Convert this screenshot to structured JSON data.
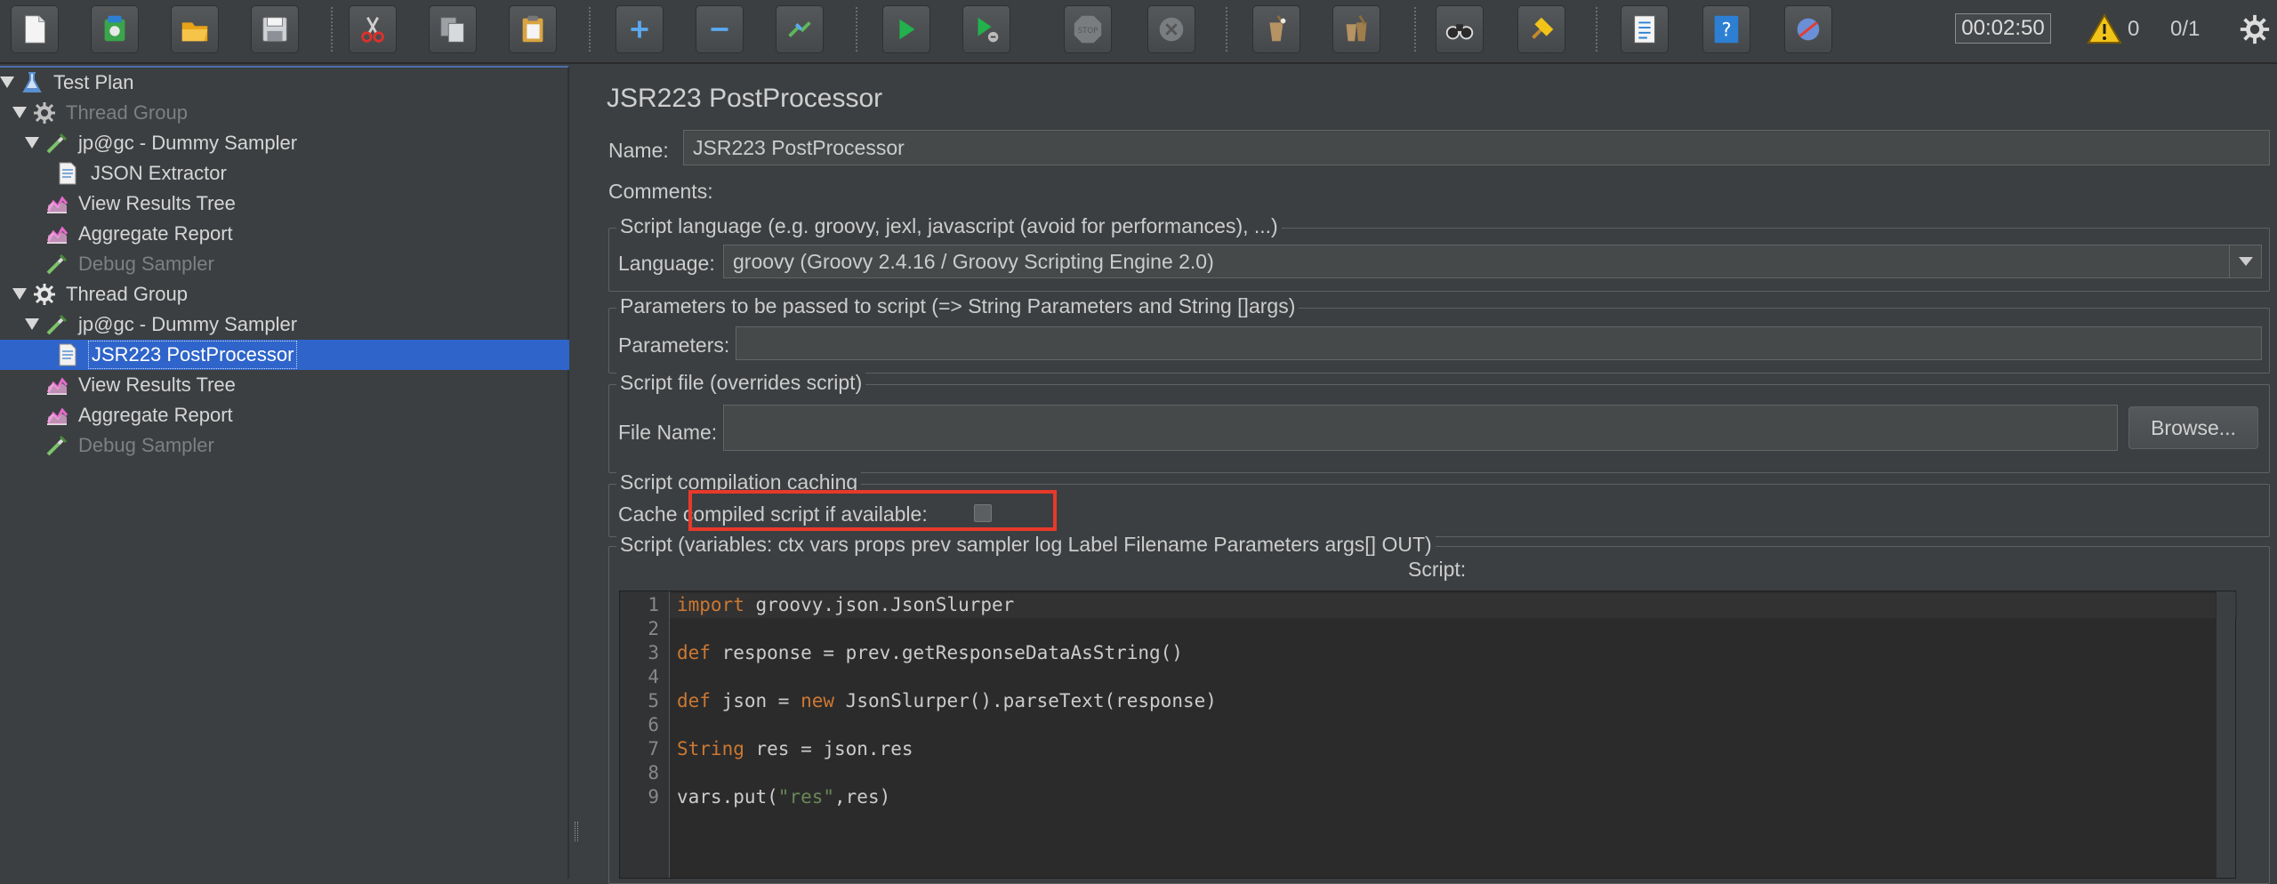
{
  "toolbar": {
    "buttons": [
      {
        "name": "new-icon"
      },
      {
        "name": "templates-icon"
      },
      {
        "name": "open-icon"
      },
      {
        "name": "save-icon"
      },
      {
        "name": "cut-icon"
      },
      {
        "name": "copy-icon"
      },
      {
        "name": "paste-icon"
      },
      {
        "name": "expand-icon"
      },
      {
        "name": "collapse-icon"
      },
      {
        "name": "toggle-icon"
      },
      {
        "name": "start-icon"
      },
      {
        "name": "start-no-pauses-icon"
      },
      {
        "name": "stop-icon"
      },
      {
        "name": "shutdown-icon"
      },
      {
        "name": "clear-icon"
      },
      {
        "name": "clear-all-icon"
      },
      {
        "name": "search-icon"
      },
      {
        "name": "reset-search-icon"
      },
      {
        "name": "function-helper-icon"
      },
      {
        "name": "help-icon"
      }
    ],
    "timer": "00:02:50",
    "warning_count": "0",
    "threads": "0/1",
    "colors": {
      "start": "#22b14c",
      "warning": "#f2c318"
    }
  },
  "tree": {
    "items": [
      {
        "label": "Test Plan",
        "icon": "flask-icon",
        "level": 0,
        "expanded": true,
        "disabled": false
      },
      {
        "label": "Thread Group",
        "icon": "gear-icon",
        "level": 0,
        "expanded": true,
        "disabled": true
      },
      {
        "label": "jp@gc - Dummy Sampler",
        "icon": "pipette-icon",
        "level": 1,
        "expanded": true,
        "disabled": false
      },
      {
        "label": "JSON Extractor",
        "icon": "document-icon",
        "level": 2,
        "disabled": false
      },
      {
        "label": "View Results Tree",
        "icon": "chart-icon",
        "level": 1,
        "disabled": false
      },
      {
        "label": "Aggregate Report",
        "icon": "chart-icon",
        "level": 1,
        "disabled": false
      },
      {
        "label": "Debug Sampler",
        "icon": "pipette-icon",
        "level": 1,
        "disabled": true
      },
      {
        "label": "Thread Group",
        "icon": "gear-icon",
        "level": 0,
        "expanded": true,
        "disabled": false
      },
      {
        "label": "jp@gc - Dummy Sampler",
        "icon": "pipette-icon",
        "level": 1,
        "expanded": true,
        "disabled": false
      },
      {
        "label": "JSR223 PostProcessor",
        "icon": "document-icon",
        "level": 2,
        "selected": true,
        "disabled": false
      },
      {
        "label": "View Results Tree",
        "icon": "chart-icon",
        "level": 1,
        "disabled": false
      },
      {
        "label": "Aggregate Report",
        "icon": "chart-icon",
        "level": 1,
        "disabled": false
      },
      {
        "label": "Debug Sampler",
        "icon": "pipette-icon",
        "level": 1,
        "disabled": true
      }
    ]
  },
  "main": {
    "title": "JSR223 PostProcessor",
    "name_label": "Name:",
    "name_value": "JSR223 PostProcessor",
    "comments_label": "Comments:",
    "script_language": {
      "title": "Script language (e.g. groovy, jexl, javascript (avoid for performances), ...)",
      "label": "Language:",
      "value": "groovy     (Groovy 2.4.16 / Groovy Scripting Engine 2.0)"
    },
    "parameters": {
      "title": "Parameters to be passed to script (=> String Parameters and String []args)",
      "label": "Parameters:",
      "value": ""
    },
    "script_file": {
      "title": "Script file (overrides script)",
      "label": "File Name:",
      "value": "",
      "browse_label": "Browse..."
    },
    "caching": {
      "title": "Script compilation caching",
      "label": "Cache compiled script if available:",
      "checked": false
    },
    "script": {
      "title": "Script (variables: ctx vars props prev sampler log Label Filename Parameters args[] OUT)",
      "label": "Script:",
      "lines": [
        {
          "num": "1",
          "tokens": [
            {
              "t": "import",
              "c": "kw"
            },
            {
              "t": " groovy.json.JsonSlurper",
              "c": ""
            }
          ]
        },
        {
          "num": "2",
          "tokens": []
        },
        {
          "num": "3",
          "tokens": [
            {
              "t": "def",
              "c": "kw"
            },
            {
              "t": " response = prev.getResponseDataAsString()",
              "c": ""
            }
          ]
        },
        {
          "num": "4",
          "tokens": []
        },
        {
          "num": "5",
          "tokens": [
            {
              "t": "def",
              "c": "kw"
            },
            {
              "t": " json = ",
              "c": ""
            },
            {
              "t": "new",
              "c": "kw"
            },
            {
              "t": " JsonSlurper().parseText(response)",
              "c": ""
            }
          ]
        },
        {
          "num": "6",
          "tokens": []
        },
        {
          "num": "7",
          "tokens": [
            {
              "t": "String",
              "c": "type"
            },
            {
              "t": " res = json.res",
              "c": ""
            }
          ]
        },
        {
          "num": "8",
          "tokens": []
        },
        {
          "num": "9",
          "tokens": [
            {
              "t": "vars.put(",
              "c": ""
            },
            {
              "t": "\"res\"",
              "c": "str"
            },
            {
              "t": ",res)",
              "c": ""
            }
          ]
        }
      ]
    },
    "highlight_color": "#e8392b"
  }
}
